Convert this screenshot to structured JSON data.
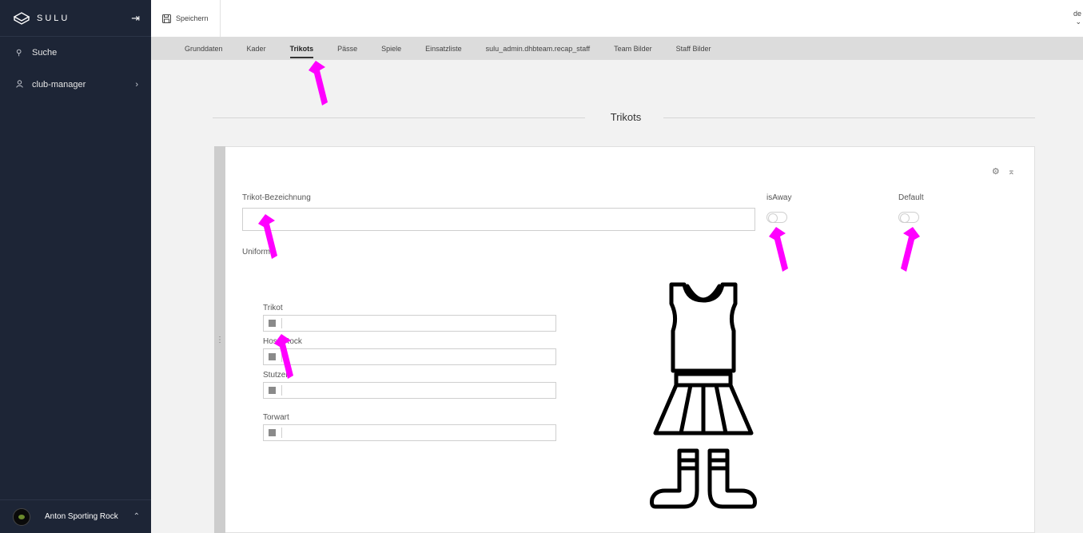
{
  "sidebar": {
    "logo_text": "SULU",
    "items": [
      {
        "label": "Suche",
        "icon": "search-icon"
      },
      {
        "label": "club-manager",
        "icon": "user-icon"
      }
    ],
    "footer": {
      "user_name": "Anton Sporting Rock"
    }
  },
  "toolbar": {
    "save_label": "Speichern",
    "locale": "de"
  },
  "tabs": [
    {
      "label": "Grunddaten"
    },
    {
      "label": "Kader"
    },
    {
      "label": "Trikots",
      "active": true
    },
    {
      "label": "Pässe"
    },
    {
      "label": "Spiele"
    },
    {
      "label": "Einsatzliste"
    },
    {
      "label": "sulu_admin.dhbteam.recap_staff"
    },
    {
      "label": "Team Bilder"
    },
    {
      "label": "Staff Bilder"
    }
  ],
  "section": {
    "title": "Trikots"
  },
  "form": {
    "name_label": "Trikot-Bezeichnung",
    "name_value": "",
    "is_away_label": "isAway",
    "default_label": "Default",
    "uniform_label": "Uniform",
    "colors": [
      {
        "label": "Trikot",
        "value": ""
      },
      {
        "label": "Hose/Rock",
        "value": ""
      },
      {
        "label": "Stutzen",
        "value": ""
      },
      {
        "label": "Torwart",
        "value": ""
      }
    ]
  },
  "colors": {
    "sidebar_bg": "#1d2536",
    "annotation_arrow": "#ff00ff"
  }
}
